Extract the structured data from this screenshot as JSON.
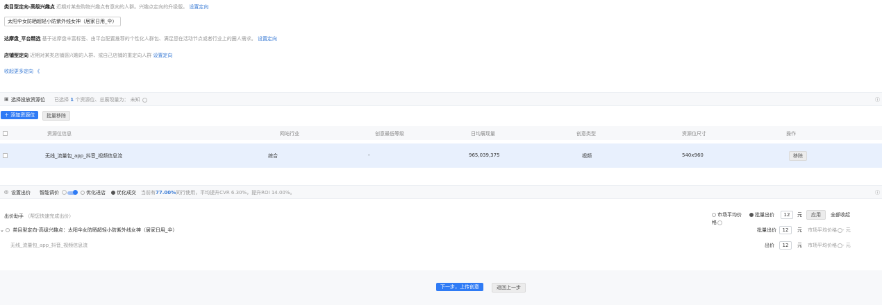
{
  "targeting": {
    "category": {
      "title": "类目型定向-高级兴趣点",
      "desc": "近期对某些购物兴趣点有意向的人群。兴趣点定向的升级版。",
      "action": "设置定向",
      "tag": "太阳伞女防晒超轻小防紫外线女神（居家日用_伞）"
    },
    "dmp": {
      "title": "达摩盘_平台精选",
      "desc": "基于达摩盘丰富标签、由平台配置推荐的个性化人群包、满足您在活动节点或者行业上的圈人需求。",
      "action": "设置定向"
    },
    "store": {
      "title": "店铺型定向",
      "desc": "近期对某类店铺感兴趣的人群、或自己店铺的重定向人群",
      "action": "设置定向"
    },
    "collapse_link": "收起更多定向 《"
  },
  "placement_bar": {
    "title": "选择投放资源位",
    "summary_prefix": "已选择",
    "count": "1",
    "summary_mid": "个资源位、总展现量为：",
    "summary_value": "未知",
    "info_icon": "info-icon"
  },
  "placement_actions": {
    "add": "＋ 添加资源位",
    "bulk_remove": "批量移除"
  },
  "table": {
    "columns": [
      "资源位信息",
      "网站行业",
      "创意最低等级",
      "日均展现量",
      "创意类型",
      "资源位尺寸",
      "操作"
    ],
    "rows": [
      {
        "name": "无线_流量包_app_抖音_视频信息流",
        "industry": "综合",
        "level": "-",
        "impressions": "965,039,375",
        "creative_type": "视频",
        "size": "540x960",
        "action": "移除"
      }
    ]
  },
  "bid_bar": {
    "title": "设置出价",
    "smart_label": "智能调价",
    "opt_store": "优化进店",
    "opt_deal": "优化成交",
    "note_prefix": "当前有",
    "note_pct": "77.00%",
    "note_suffix": "同行使用，平均提升CVR 6.30%，提升ROI 14.00%。"
  },
  "bid_helper": {
    "title": "出价助手",
    "subtitle": "（帮您快速完成出价）",
    "market_avg": "市场平均价",
    "market_avg_2": "格",
    "batch_bid": "批量出价",
    "batch_value": "12",
    "unit": "元",
    "apply": "应用",
    "collapse_all": "全部收起",
    "group_label": "类目型定向-高级兴趣点：太阳伞女防晒超轻小防紫外线女神（居家日用_伞）",
    "group_bid_label": "批量出价",
    "group_bid_value": "12",
    "market_avg_price": "市场平均价格",
    "dash": "- 元",
    "item_label": "无线_流量包_app_抖音_视频信息流",
    "item_bid_label": "出价",
    "item_bid_value": "12"
  },
  "footer": {
    "next": "下一步，上传创意",
    "back": "返回上一步"
  }
}
